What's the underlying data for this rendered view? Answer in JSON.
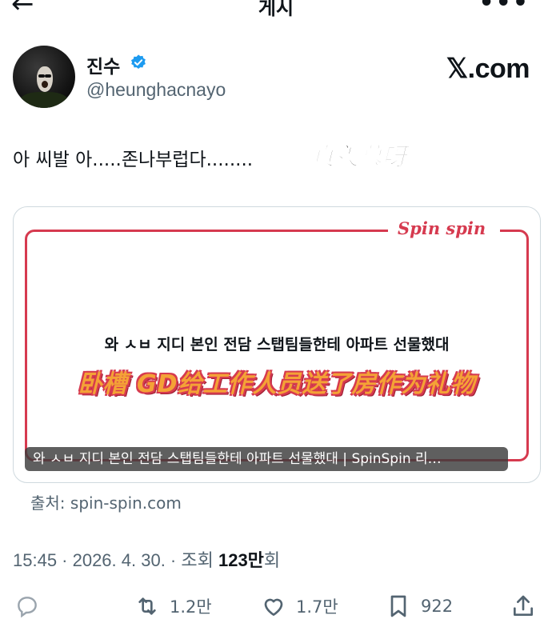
{
  "header": {
    "back_icon": "arrow-left-icon",
    "title": "게시",
    "more_icon": "more-dots-icon"
  },
  "author": {
    "name": "진수",
    "handle": "@heunghacnayo",
    "verified_icon": "verified-badge-icon",
    "verified_color": "#1d9bf0"
  },
  "brand_logo": "𝕏.com",
  "tweet": {
    "text": "아 씨발 아.....존나부럽다........",
    "sticker": "真羡慕呀"
  },
  "card": {
    "brand": "Spin spin",
    "headline": "와 ㅅㅂ 지디 본인 전담 스탭팀들한테 아파트 선물했대",
    "overlay_cn": "卧槽 GD给工作人员送了房作为礼物",
    "caption": "와 ㅅㅂ 지디 본인 전담 스탭팀들한테 아파트 선물했대 | SpinSpin 리…",
    "accent_color": "#d63a4f"
  },
  "source": "출처: spin-spin.com",
  "meta": {
    "time_date": "15:45 · 2026. 4. 30. · 조회 ",
    "views": "123만",
    "views_suffix": "회"
  },
  "actions": {
    "reply_icon": "reply-icon",
    "retweet_icon": "retweet-icon",
    "retweet_count": "1.2만",
    "like_icon": "heart-icon",
    "like_count": "1.7만",
    "bookmark_icon": "bookmark-icon",
    "bookmark_count": "922",
    "share_icon": "share-icon"
  }
}
